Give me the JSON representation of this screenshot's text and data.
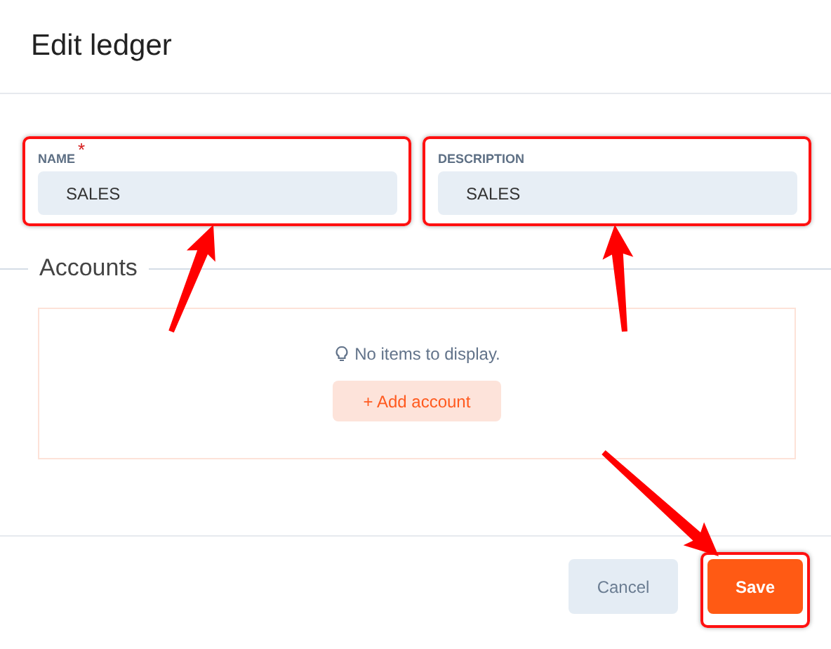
{
  "dialog": {
    "title": "Edit ledger"
  },
  "fields": [
    {
      "label": "NAME",
      "required_mark": "*",
      "value": "SALES",
      "highlighted": true
    },
    {
      "label": "DESCRIPTION",
      "value": "SALES",
      "highlighted": true
    }
  ],
  "accounts": {
    "title": "Accounts",
    "empty_message": "No items to display.",
    "add_button": "+ Add account"
  },
  "buttons": [
    {
      "label": "Cancel",
      "kind": "secondary",
      "highlighted": false
    },
    {
      "label": "Save",
      "kind": "primary",
      "highlighted": true
    }
  ]
}
